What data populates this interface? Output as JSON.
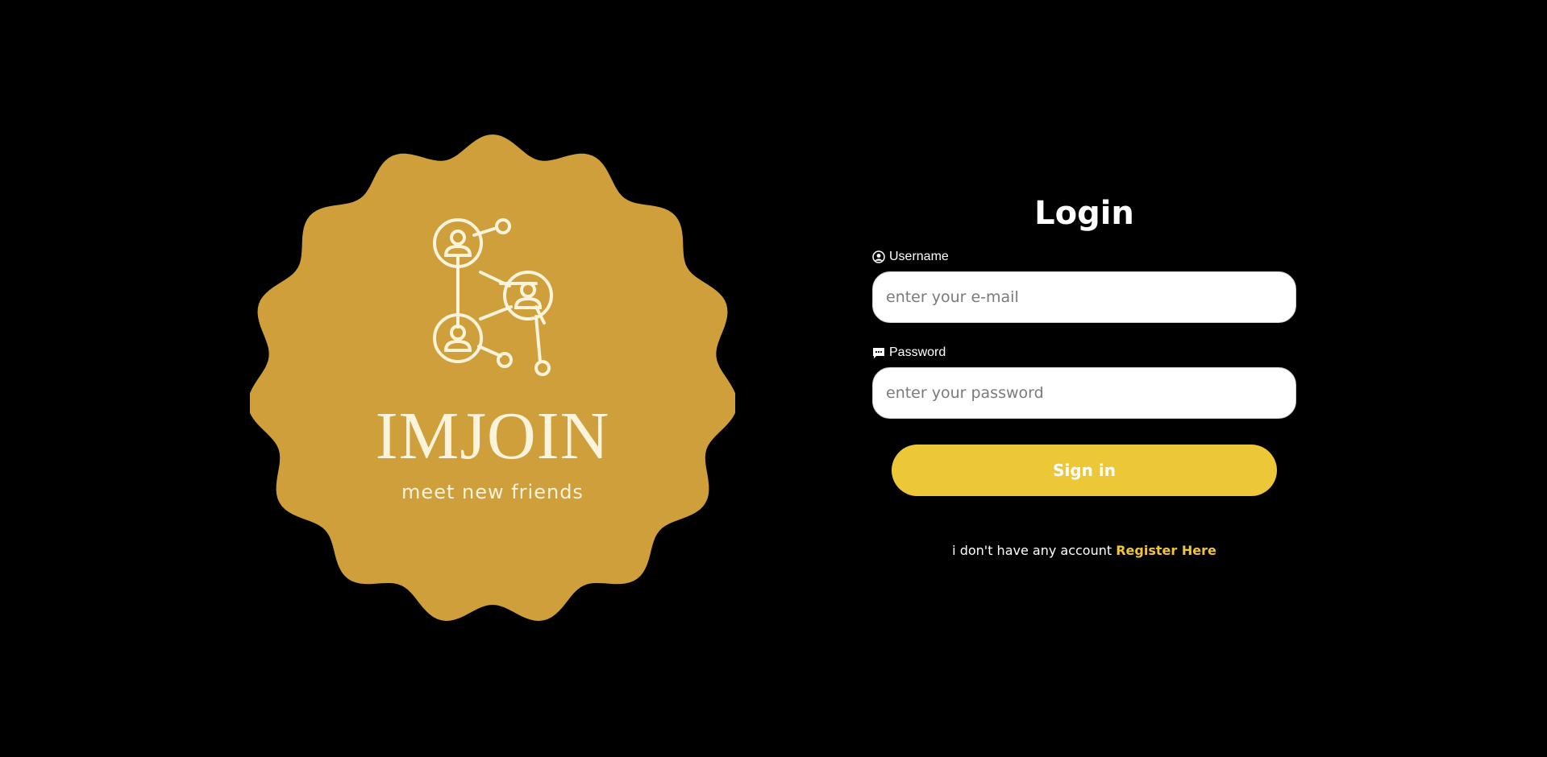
{
  "logo": {
    "wordmark": "IMJOIN",
    "tagline": "meet new friends",
    "badge_color": "#ce9f3b",
    "ink_color": "#fbf3da",
    "icon": "network-people-icon"
  },
  "login": {
    "title": "Login",
    "username": {
      "label": "Username",
      "icon": "user-circle-icon",
      "placeholder": "enter your e-mail",
      "value": ""
    },
    "password": {
      "label": "Password",
      "icon": "message-icon",
      "placeholder": "enter your password",
      "value": ""
    },
    "submit_label": "Sign in",
    "register_prompt": "i don't have any account",
    "register_link": "Register Here"
  },
  "colors": {
    "background": "#000000",
    "accent": "#ecc838",
    "link": "#f0c53a"
  }
}
